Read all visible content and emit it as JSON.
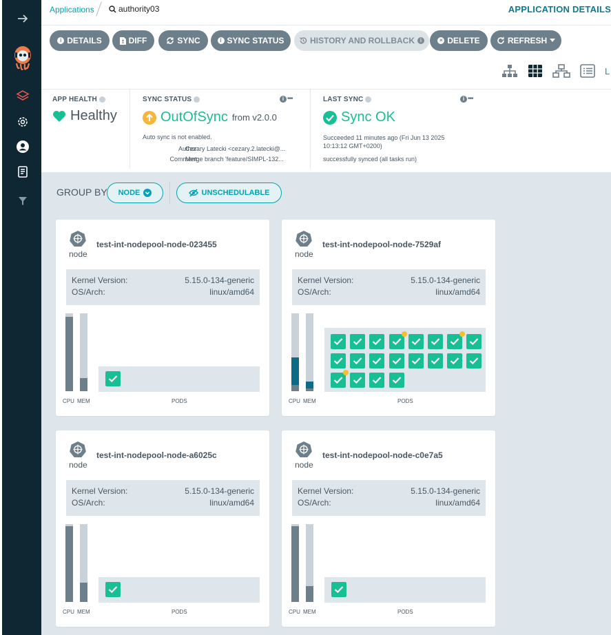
{
  "breadcrumb": {
    "link": "Applications",
    "search_text": "authority03"
  },
  "header": {
    "title": "APPLICATION DETAILS"
  },
  "toolbar": {
    "details": "DETAILS",
    "diff": "DIFF",
    "sync": "SYNC",
    "sync_status": "SYNC STATUS",
    "history": "HISTORY AND ROLLBACK",
    "delete": "DELETE",
    "refresh": "REFRESH"
  },
  "status": {
    "app_health": {
      "title": "APP HEALTH",
      "value": "Healthy"
    },
    "sync_status": {
      "title": "SYNC STATUS",
      "value": "OutOfSync",
      "from": "from v2.0.0",
      "auto_sync": "Auto sync is not enabled.",
      "author_label": "Author:",
      "author_value": "Cezary Latecki <cezary.2.latecki@...",
      "comment_label": "Comment:",
      "comment_value": "Merge branch 'feature/SIMPL-132..."
    },
    "last_sync": {
      "title": "LAST SYNC",
      "value": "Sync OK",
      "line1": "Succeeded 11 minutes ago (Fri Jun 13 2025",
      "line2": "10:13:12 GMT+0200)",
      "line3": "successfully synced (all tasks run)"
    }
  },
  "group_by": {
    "label": "GROUP BY:",
    "node": "NODE",
    "unschedulable": "UNSCHEDULABLE"
  },
  "colors": {
    "brand": "#00a2b3",
    "healthy": "#18be94",
    "out_of_sync": "#f4b73e",
    "sidebar": "#0f2733"
  },
  "nodes": [
    {
      "type": "node",
      "name": "test-int-nodepool-node-023455",
      "kernel_label": "Kernel Version:",
      "kernel": "5.15.0-134-generic",
      "os_label": "OS/Arch:",
      "os": "linux/amd64",
      "cpu_label": "CPU",
      "mem_label": "MEM",
      "pods_label": "PODS",
      "cpu_fraction": 0.96,
      "mem_fraction": 0.17,
      "pods": [
        {
          "dot": false
        }
      ]
    },
    {
      "type": "node",
      "name": "test-int-nodepool-node-7529af",
      "kernel_label": "Kernel Version:",
      "kernel": "5.15.0-134-generic",
      "os_label": "OS/Arch:",
      "os": "linux/amd64",
      "cpu_label": "CPU",
      "mem_label": "MEM",
      "pods_label": "PODS",
      "cpu_fraction": 0.43,
      "mem_fraction": 0.12,
      "pods": [
        {
          "dot": false
        },
        {
          "dot": false
        },
        {
          "dot": false
        },
        {
          "dot": true
        },
        {
          "dot": false
        },
        {
          "dot": false
        },
        {
          "dot": true
        },
        {
          "dot": false
        },
        {
          "dot": false
        },
        {
          "dot": false
        },
        {
          "dot": false
        },
        {
          "dot": false
        },
        {
          "dot": false
        },
        {
          "dot": false
        },
        {
          "dot": false
        },
        {
          "dot": false
        },
        {
          "dot": true
        },
        {
          "dot": false
        },
        {
          "dot": false
        },
        {
          "dot": false
        }
      ]
    },
    {
      "type": "node",
      "name": "test-int-nodepool-node-a6025c",
      "kernel_label": "Kernel Version:",
      "kernel": "5.15.0-134-generic",
      "os_label": "OS/Arch:",
      "os": "linux/amd64",
      "cpu_label": "CPU",
      "mem_label": "MEM",
      "pods_label": "PODS",
      "cpu_fraction": 0.97,
      "mem_fraction": 0.25,
      "pods": [
        {
          "dot": false
        }
      ]
    },
    {
      "type": "node",
      "name": "test-int-nodepool-node-c0e7a5",
      "kernel_label": "Kernel Version:",
      "kernel": "5.15.0-134-generic",
      "os_label": "OS/Arch:",
      "os": "linux/amd64",
      "cpu_label": "CPU",
      "mem_label": "MEM",
      "pods_label": "PODS",
      "cpu_fraction": 0.97,
      "mem_fraction": 0.2,
      "pods": [
        {
          "dot": false
        }
      ]
    }
  ]
}
